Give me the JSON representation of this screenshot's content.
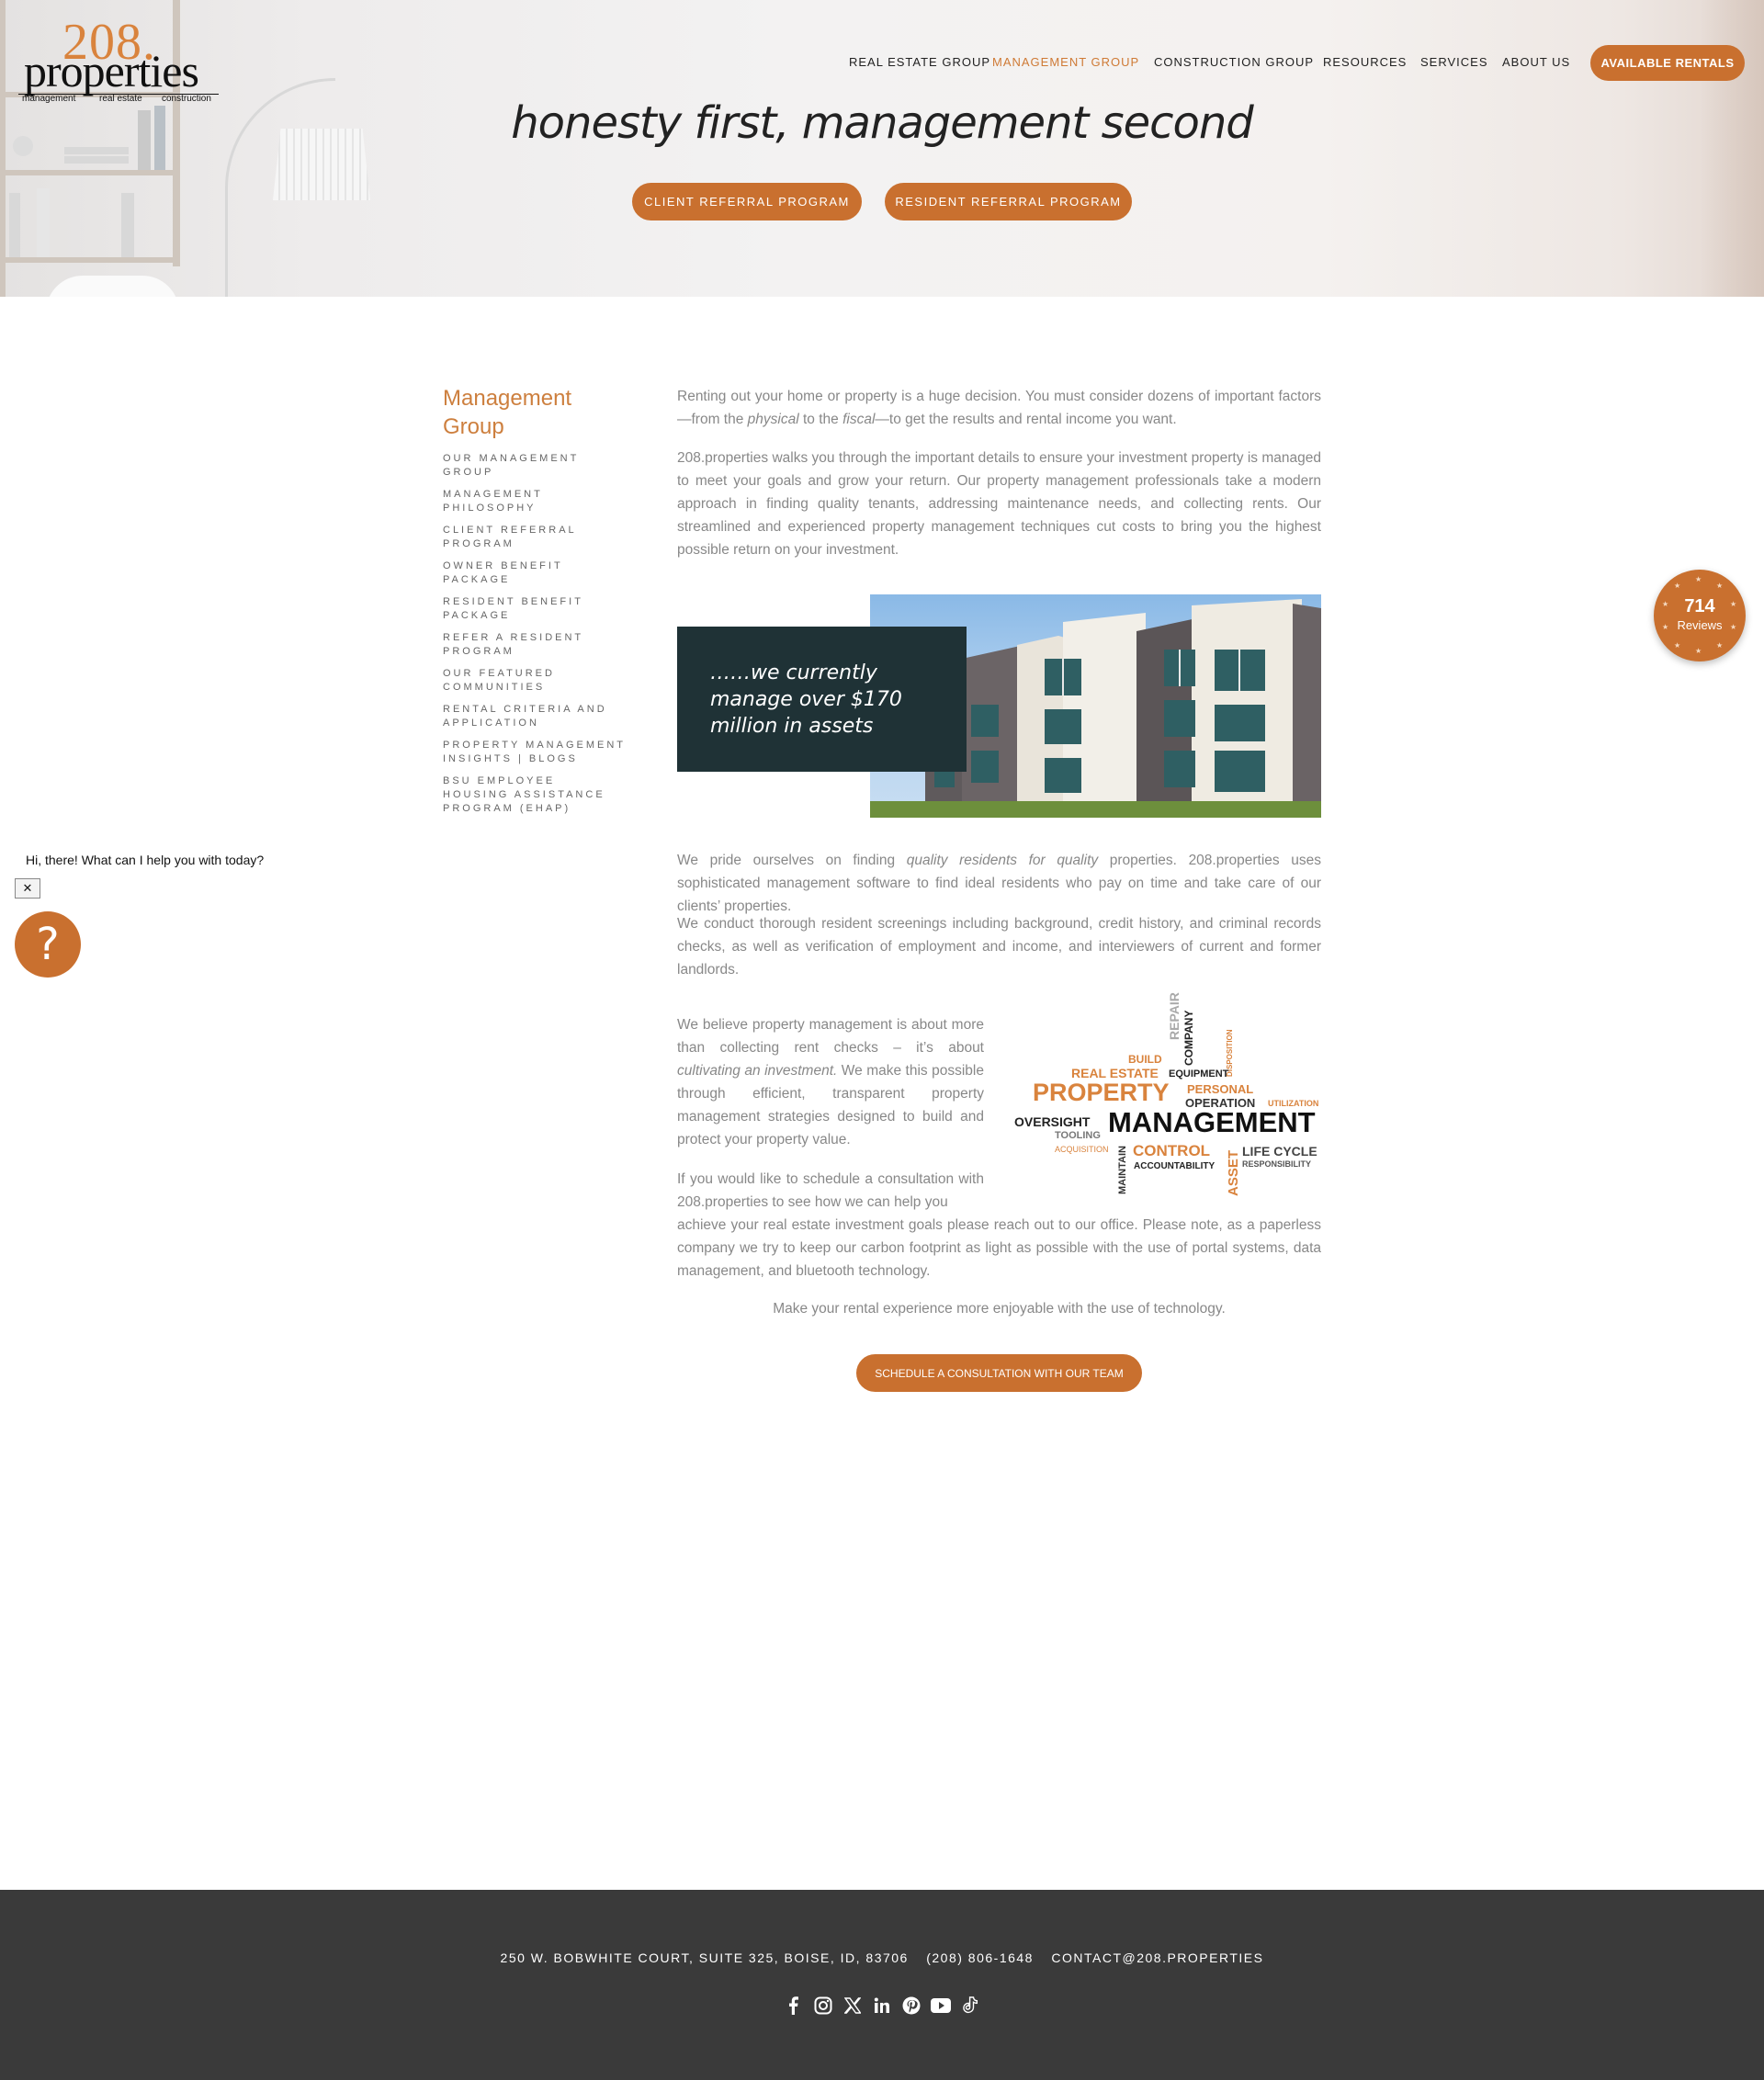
{
  "logo": {
    "number": "208.",
    "word": "properties",
    "sub": [
      "management",
      "real estate",
      "construction"
    ]
  },
  "nav": {
    "items": [
      "REAL ESTATE GROUP",
      "MANAGEMENT GROUP",
      "CONSTRUCTION GROUP",
      "RESOURCES",
      "SERVICES",
      "ABOUT US"
    ],
    "active": "MANAGEMENT GROUP",
    "cta": "AVAILABLE RENTALS"
  },
  "hero": {
    "tagline": "honesty first, management second",
    "buttons": [
      "CLIENT REFERRAL PROGRAM",
      "RESIDENT REFERRAL PROGRAM"
    ]
  },
  "sidebar": {
    "title": "Management Group",
    "items": [
      "OUR MANAGEMENT GROUP",
      "MANAGEMENT PHILOSOPHY",
      "CLIENT REFERRAL PROGRAM",
      "OWNER BENEFIT PACKAGE",
      "RESIDENT BENEFIT PACKAGE",
      "REFER A RESIDENT PROGRAM",
      "OUR FEATURED COMMUNITIES",
      "RENTAL CRITERIA AND APPLICATION",
      "PROPERTY MANAGEMENT INSIGHTS | BLOGS",
      "BSU EMPLOYEE HOUSING ASSISTANCE PROGRAM (EHAP)"
    ]
  },
  "content": {
    "p1_a": "Renting out your home or property is a huge decision. You must consider dozens of important factors—from the ",
    "p1_em1": "physical",
    "p1_b": " to the ",
    "p1_em2": "fiscal",
    "p1_c": "—to get the results and rental income you want.",
    "p2": "208.properties walks you through the important details to ensure your investment property is managed to meet your goals and grow your return. Our property management professionals take a modern approach in finding quality tenants, addressing maintenance needs, and collecting rents. Our streamlined and experienced property management techniques cut costs to bring you the highest possible return on your investment.",
    "quote": "……we currently manage over $170 million in assets",
    "p3_a": "We pride ourselves on finding ",
    "p3_em": "quality residents for quality",
    "p3_b": " properties. 208.properties uses sophisticated management software to find ideal residents who pay on time and take care of our clients’ properties.",
    "p4": "We conduct thorough resident screenings including background, credit history, and criminal records checks, as well as verification of employment and income, and interviewers of current and former landlords.",
    "p5_a": "We believe property management is about more than collecting rent checks – it’s about ",
    "p5_em": "cultivating an investment.",
    "p5_b": " We make this possible through efficient, transparent property management strategies designed to build and protect your property value.",
    "p6_top": "If you would like to schedule a consultation with 208.properties to see how we can help you",
    "p6_rest": "achieve your real estate investment goals please reach out to our office. Please note, as a paperless company we try to keep our carbon footprint as light as possible with the use of portal systems, data management, and bluetooth technology.",
    "center_line": "Make your rental experience more enjoyable with the use of technology.",
    "consult_button": "SCHEDULE A CONSULTATION WITH OUR TEAM"
  },
  "wordcloud": {
    "words": [
      "REPAIR",
      "COMPANY",
      "DISPOSITION",
      "BUILD",
      "REAL ESTATE",
      "EQUIPMENT",
      "PROPERTY",
      "PERSONAL",
      "OPERATION",
      "UTILIZATION",
      "OVERSIGHT",
      "TOOLING",
      "MANAGEMENT",
      "ACQUISITION",
      "MAINTAIN",
      "CONTROL",
      "ACCOUNTABILITY",
      "ASSET",
      "LIFE CYCLE",
      "RESPONSIBILITY"
    ]
  },
  "reviews": {
    "count": "714",
    "label": "Reviews"
  },
  "chat": {
    "message": "Hi, there! What can I help you with today?",
    "close": "✕",
    "icon": "?"
  },
  "footer": {
    "address": "250 W. BOBWHITE COURT, SUITE 325, BOISE, ID, 83706",
    "phone": "(208) 806-1648",
    "email": "CONTACT@208.PROPERTIES",
    "social": [
      "facebook-icon",
      "instagram-icon",
      "x-icon",
      "linkedin-icon",
      "pinterest-icon",
      "youtube-icon",
      "tiktok-icon"
    ]
  },
  "colors": {
    "accent": "#c9702f",
    "accent_text": "#cd7f3e",
    "dark_box": "#1f3236",
    "footer": "#3a3a3a"
  }
}
